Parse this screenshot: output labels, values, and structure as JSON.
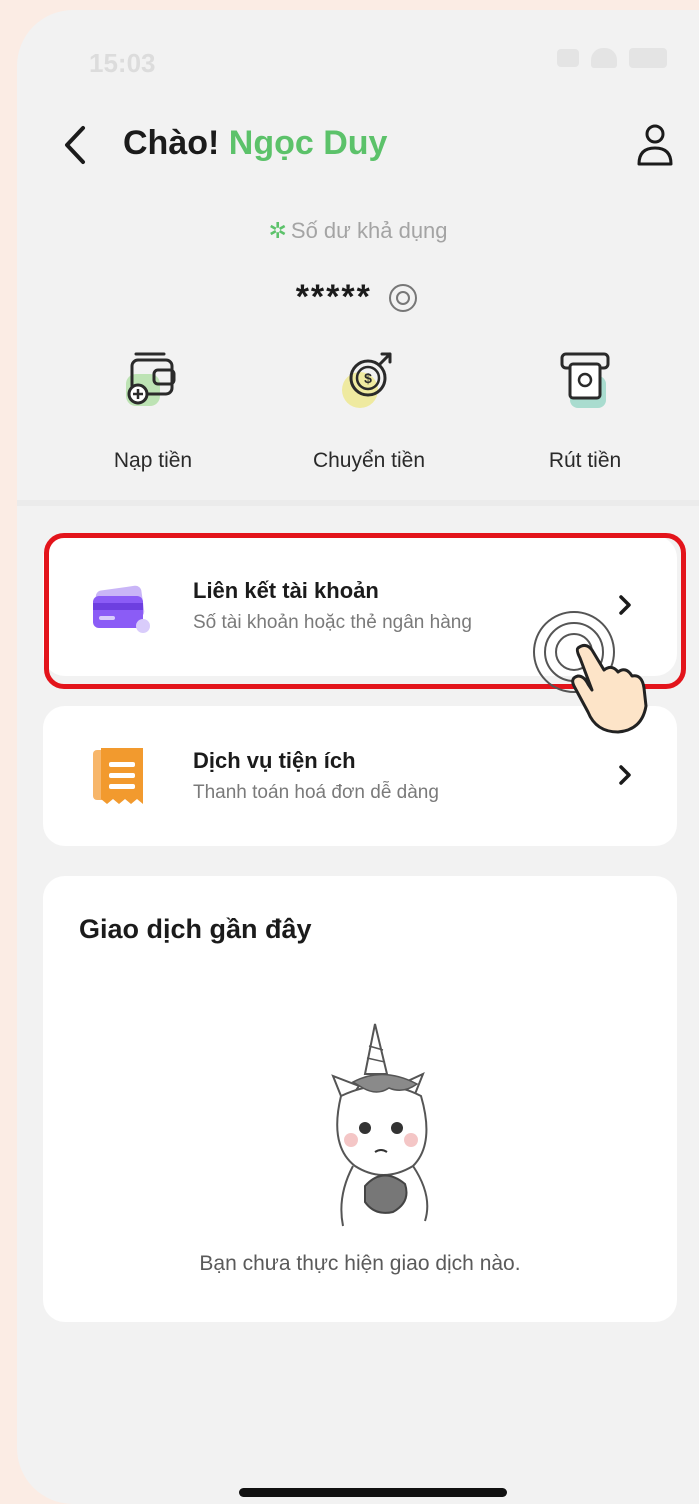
{
  "status_bar": {
    "time": "15:03"
  },
  "header": {
    "greeting": "Chào!",
    "user_name": "Ngọc Duy"
  },
  "balance": {
    "label": "Số dư khả dụng",
    "value": "*****"
  },
  "actions": [
    {
      "label": "Nạp tiền",
      "icon": "wallet-add-icon"
    },
    {
      "label": "Chuyển tiền",
      "icon": "money-transfer-icon"
    },
    {
      "label": "Rút tiền",
      "icon": "atm-withdraw-icon"
    }
  ],
  "menu": [
    {
      "title": "Liên kết tài khoản",
      "subtitle": "Số tài khoản hoặc thẻ ngân hàng",
      "icon": "bank-card-icon"
    },
    {
      "title": "Dịch vụ tiện ích",
      "subtitle": "Thanh toán hoá đơn dễ dàng",
      "icon": "receipt-icon"
    }
  ],
  "recent": {
    "title": "Giao dịch gần đây",
    "empty_message": "Bạn chưa thực hiện giao dịch nào."
  },
  "colors": {
    "brand_green": "#5cc26a",
    "highlight_red": "#e3141b",
    "page_bg": "#fbece4",
    "card_purple": "#8b5cf6",
    "receipt_orange": "#f29a2e"
  }
}
